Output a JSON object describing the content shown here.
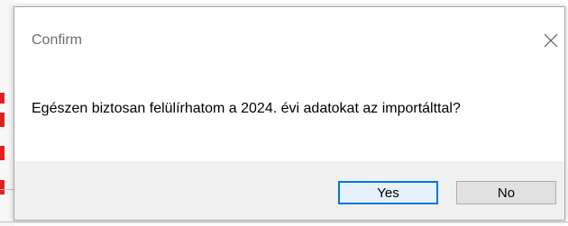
{
  "dialog": {
    "title": "Confirm",
    "message": "Egészen biztosan felülírhatom a 2024. évi adatokat az importálttal?",
    "buttons": {
      "yes_label": "Yes",
      "no_label": "No"
    },
    "close_icon": "close-icon"
  },
  "colors": {
    "accent": "#0078d7",
    "footer_bg": "#f0f0f0",
    "title_text": "#6d6d6d",
    "background_marks": "#e02020"
  }
}
